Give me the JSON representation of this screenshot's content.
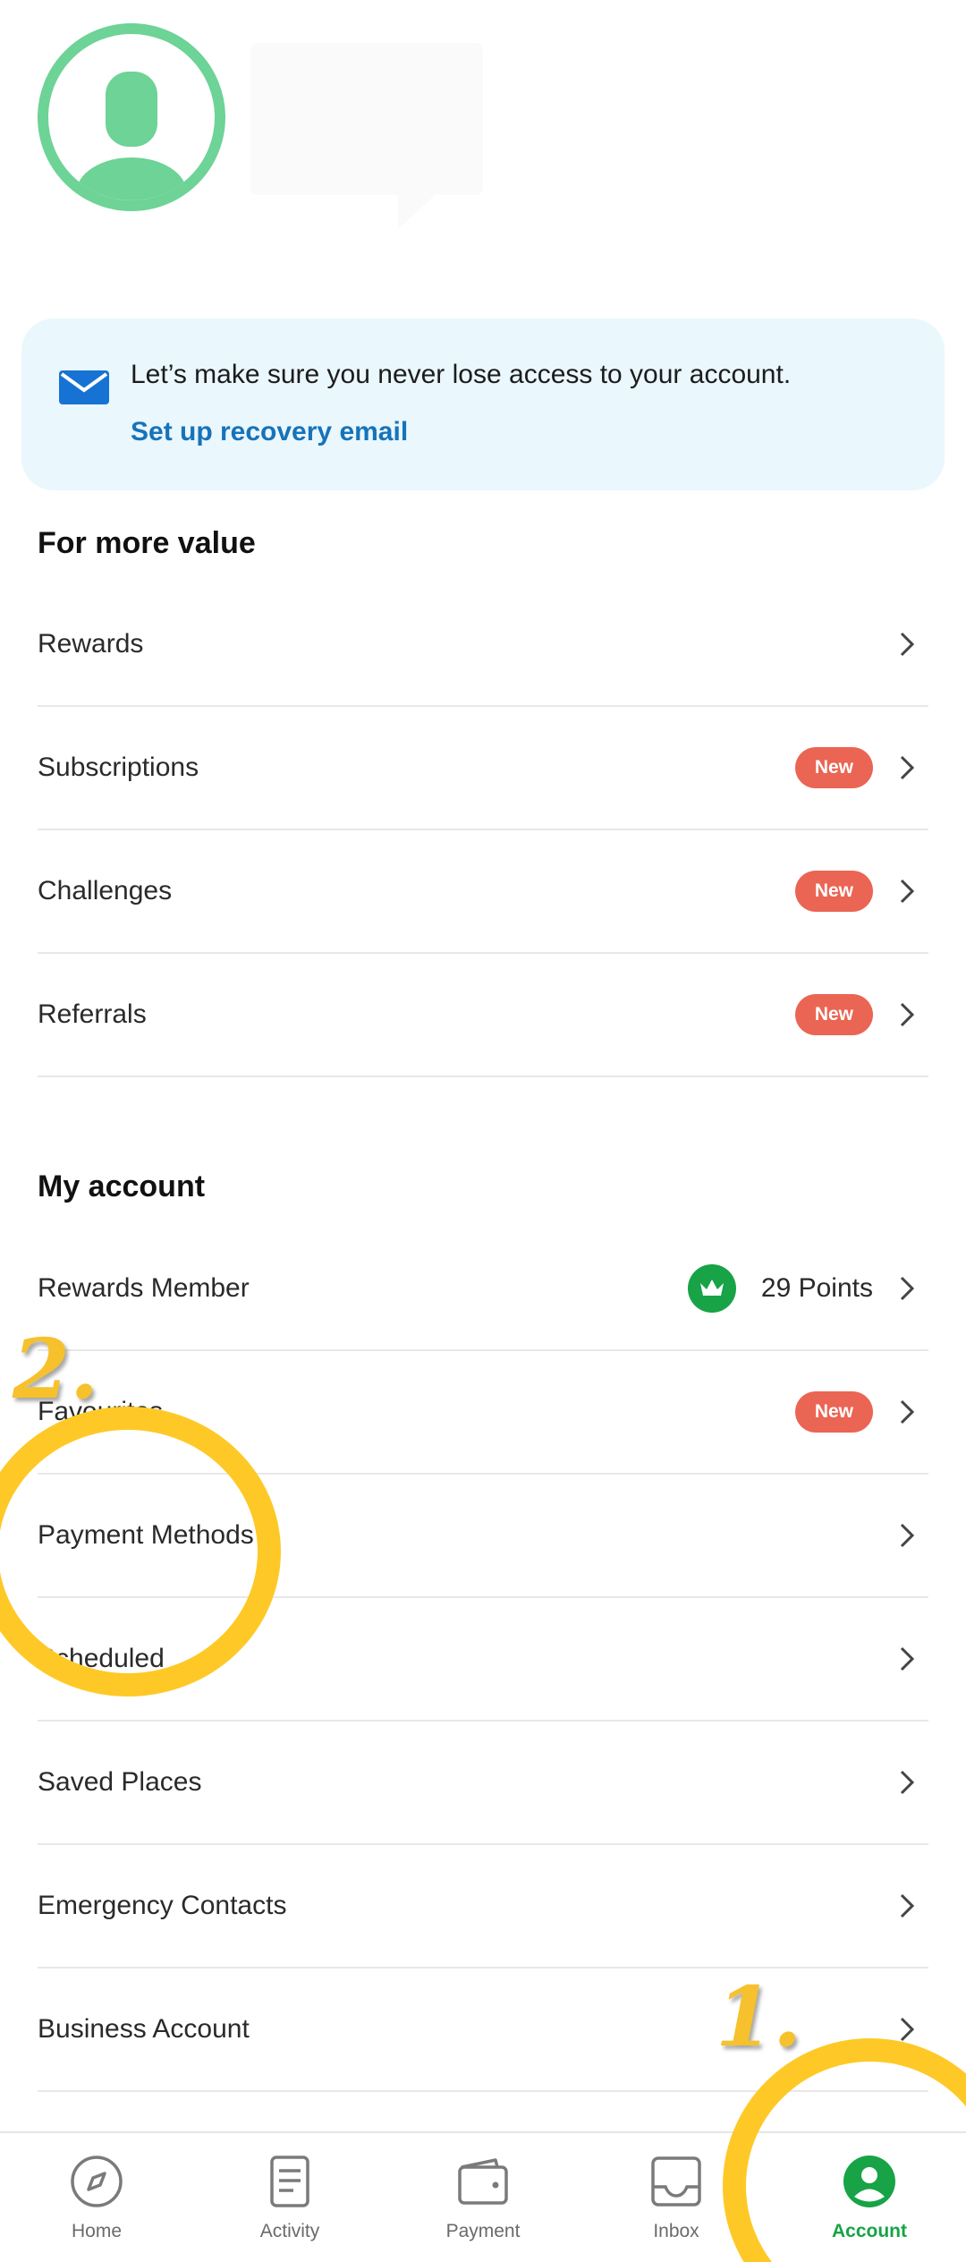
{
  "banner": {
    "message": "Let’s make sure you never lose access to your account.",
    "link": "Set up recovery email",
    "icon": "envelope-icon"
  },
  "sections": {
    "more_value": {
      "title": "For more value",
      "items": [
        {
          "label": "Rewards"
        },
        {
          "label": "Subscriptions",
          "badge": "New"
        },
        {
          "label": "Challenges",
          "badge": "New"
        },
        {
          "label": "Referrals",
          "badge": "New"
        }
      ]
    },
    "my_account": {
      "title": "My account",
      "items": [
        {
          "label": "Rewards Member",
          "points": "29 Points"
        },
        {
          "label": "Favourites",
          "badge": "New"
        },
        {
          "label": "Payment Methods"
        },
        {
          "label": "Scheduled"
        },
        {
          "label": "Saved Places"
        },
        {
          "label": "Emergency Contacts"
        },
        {
          "label": "Business Account"
        }
      ]
    }
  },
  "annotations": {
    "step1": "1.",
    "step2": "2."
  },
  "nav": {
    "items": [
      {
        "label": "Home",
        "icon": "compass-icon"
      },
      {
        "label": "Activity",
        "icon": "document-icon"
      },
      {
        "label": "Payment",
        "icon": "wallet-icon"
      },
      {
        "label": "Inbox",
        "icon": "inbox-icon"
      },
      {
        "label": "Account",
        "icon": "account-icon",
        "active": true
      }
    ]
  },
  "colors": {
    "brand_green": "#17a346",
    "avatar_green": "#6dd396",
    "badge_red": "#ea6553",
    "link_blue": "#1773b9",
    "banner_bg": "#eaf7fc",
    "annotation_yellow": "#fec927"
  }
}
